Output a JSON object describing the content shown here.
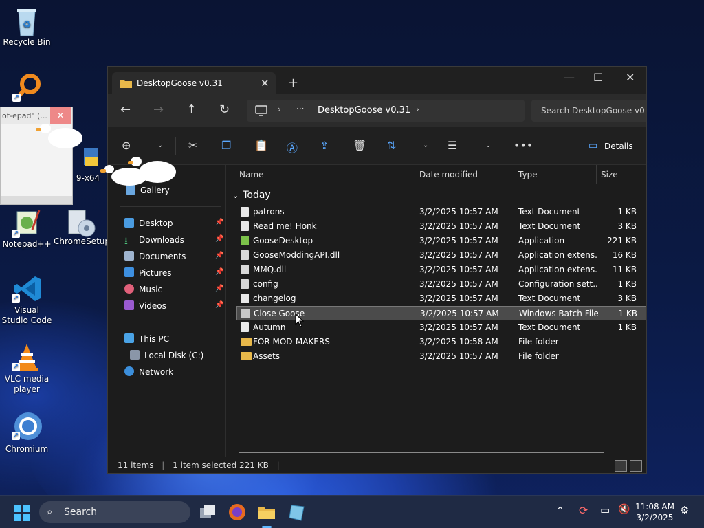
{
  "desktop": {
    "icons": [
      {
        "label": "Recycle Bin"
      },
      {
        "label": "Notepad++"
      },
      {
        "label": "ChromeSetup"
      },
      {
        "label": "Visual Studio Code"
      },
      {
        "label": "VLC media player"
      },
      {
        "label": "Chromium"
      },
      {
        "label": "9-x64"
      }
    ],
    "notepad_title": "ot-epad\" (..."
  },
  "explorer": {
    "tab_title": "DesktopGoose v0.31",
    "path_crumb": "DesktopGoose v0.31",
    "search_placeholder": "Search DesktopGoose v0",
    "details_label": "Details",
    "sidebar": {
      "gallery": "Gallery",
      "pinned": [
        "Desktop",
        "Downloads",
        "Documents",
        "Pictures",
        "Music",
        "Videos"
      ],
      "this_pc": "This PC",
      "local_disk": "Local Disk (C:)",
      "network": "Network"
    },
    "columns": {
      "name": "Name",
      "date": "Date modified",
      "type": "Type",
      "size": "Size"
    },
    "group": "Today",
    "files": [
      {
        "name": "patrons",
        "date": "3/2/2025 10:57 AM",
        "type": "Text Document",
        "size": "1 KB",
        "icon": "text"
      },
      {
        "name": "Read me! Honk",
        "date": "3/2/2025 10:57 AM",
        "type": "Text Document",
        "size": "3 KB",
        "icon": "text"
      },
      {
        "name": "GooseDesktop",
        "date": "3/2/2025 10:57 AM",
        "type": "Application",
        "size": "221 KB",
        "icon": "app"
      },
      {
        "name": "GooseModdingAPI.dll",
        "date": "3/2/2025 10:57 AM",
        "type": "Application extens...",
        "size": "16 KB",
        "icon": "dll"
      },
      {
        "name": "MMQ.dll",
        "date": "3/2/2025 10:57 AM",
        "type": "Application extens...",
        "size": "11 KB",
        "icon": "dll"
      },
      {
        "name": "config",
        "date": "3/2/2025 10:57 AM",
        "type": "Configuration sett...",
        "size": "1 KB",
        "icon": "config"
      },
      {
        "name": "changelog",
        "date": "3/2/2025 10:57 AM",
        "type": "Text Document",
        "size": "3 KB",
        "icon": "text"
      },
      {
        "name": "Close Goose",
        "date": "3/2/2025 10:57 AM",
        "type": "Windows Batch File",
        "size": "1 KB",
        "icon": "batch",
        "selected": true
      },
      {
        "name": "Autumn",
        "date": "3/2/2025 10:57 AM",
        "type": "Text Document",
        "size": "1 KB",
        "icon": "text"
      },
      {
        "name": "FOR MOD-MAKERS",
        "date": "3/2/2025 10:58 AM",
        "type": "File folder",
        "size": "",
        "icon": "folder"
      },
      {
        "name": "Assets",
        "date": "3/2/2025 10:57 AM",
        "type": "File folder",
        "size": "",
        "icon": "folder"
      }
    ],
    "status": {
      "count": "11 items",
      "selection": "1 item selected  221 KB"
    }
  },
  "taskbar": {
    "search_label": "Search",
    "time": "11:08 AM",
    "date": "3/2/2025"
  },
  "colors": {
    "folder": "#e8b84a",
    "app": "#7cc24a",
    "accent": "#5aa8ff"
  }
}
